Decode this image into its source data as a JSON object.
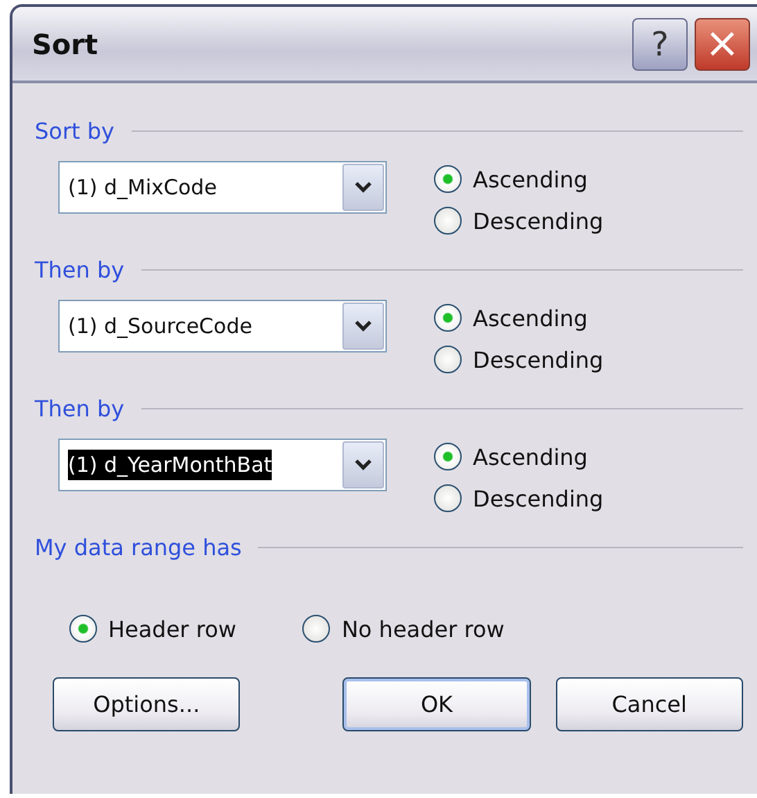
{
  "window": {
    "title": "Sort",
    "controls": [
      "?",
      "×"
    ]
  },
  "sort_levels": [
    {
      "heading": "Sort by",
      "field": "(1) d_MixCode",
      "text_selected": false,
      "orders": [
        {
          "label": "Ascending",
          "selected": true
        },
        {
          "label": "Descending",
          "selected": false
        }
      ]
    },
    {
      "heading": "Then by",
      "field": "(1) d_SourceCode",
      "text_selected": false,
      "orders": [
        {
          "label": "Ascending",
          "selected": true
        },
        {
          "label": "Descending",
          "selected": false
        }
      ]
    },
    {
      "heading": "Then by",
      "field": "(1) d_YearMonthBat",
      "text_selected": true,
      "orders": [
        {
          "label": "Ascending",
          "selected": true
        },
        {
          "label": "Descending",
          "selected": false
        }
      ]
    }
  ],
  "data_range": {
    "heading": "My data range has",
    "options": [
      {
        "label": "Header row",
        "selected": true
      },
      {
        "label": "No header row",
        "selected": false
      }
    ]
  },
  "buttons": [
    {
      "label": "Options...",
      "default": false
    },
    {
      "label": "OK",
      "default": true
    },
    {
      "label": "Cancel",
      "default": false
    }
  ]
}
